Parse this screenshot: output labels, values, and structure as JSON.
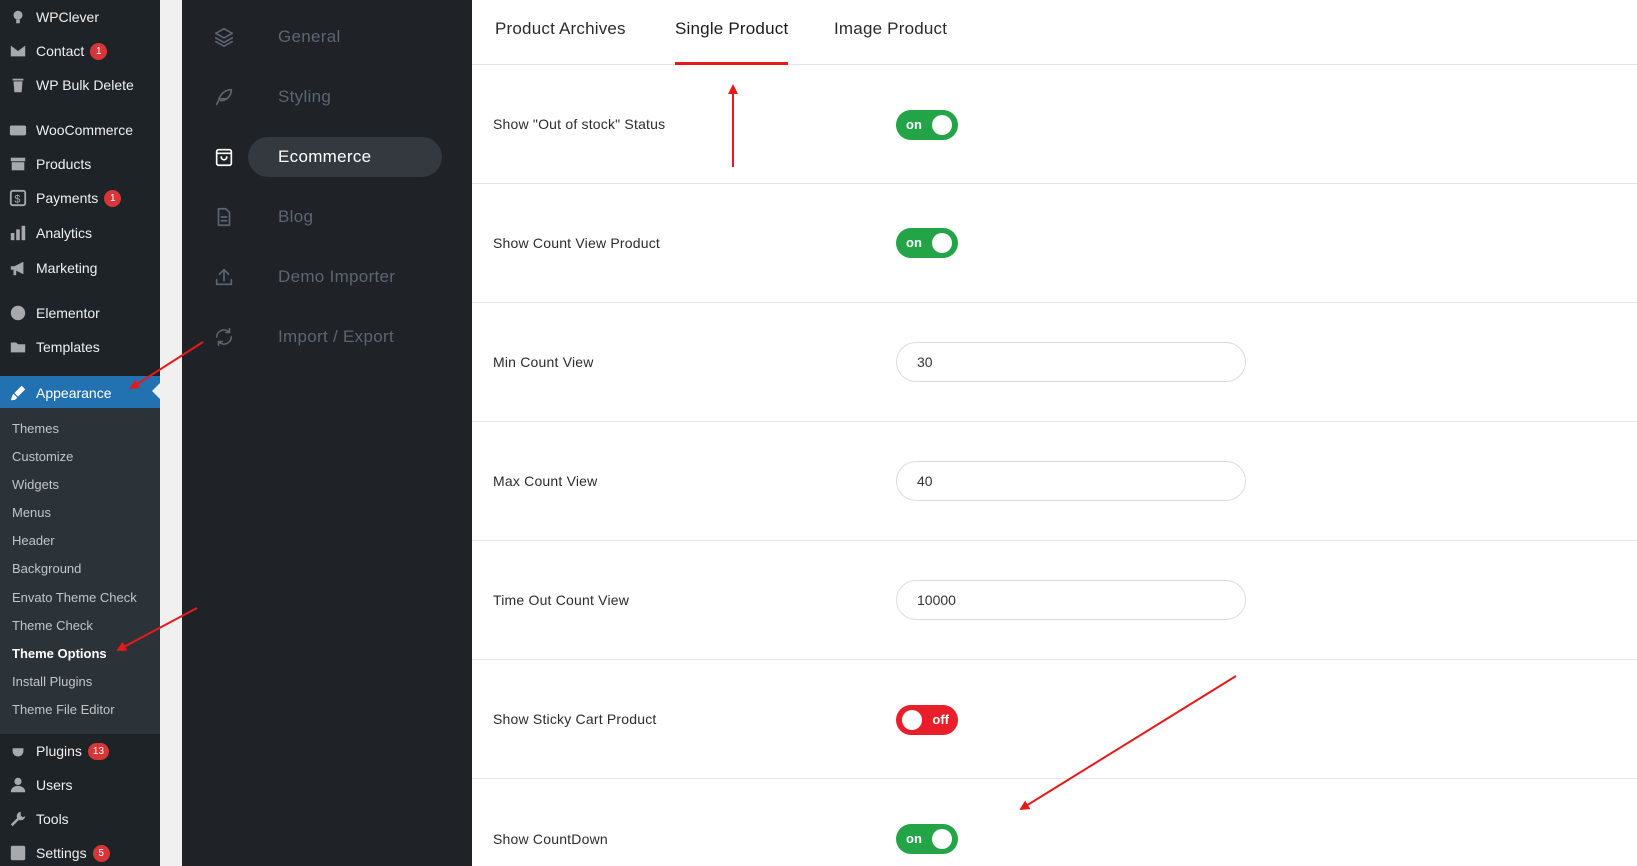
{
  "wp_menu": {
    "wpclever": "WPClever",
    "contact": "Contact",
    "contact_badge": "1",
    "wp_bulk_delete": "WP Bulk Delete",
    "woocommerce": "WooCommerce",
    "products": "Products",
    "payments": "Payments",
    "payments_badge": "1",
    "analytics": "Analytics",
    "marketing": "Marketing",
    "elementor": "Elementor",
    "templates": "Templates",
    "appearance": "Appearance",
    "plugins": "Plugins",
    "plugins_badge": "13",
    "users": "Users",
    "tools": "Tools",
    "settings": "Settings",
    "settings_badge": "5"
  },
  "appearance_submenu": {
    "themes": "Themes",
    "customize": "Customize",
    "widgets": "Widgets",
    "menus": "Menus",
    "header": "Header",
    "background": "Background",
    "envato_theme_check": "Envato Theme Check",
    "theme_check": "Theme Check",
    "theme_options": "Theme Options",
    "install_plugins": "Install Plugins",
    "theme_file_editor": "Theme File Editor"
  },
  "options_nav": {
    "general": "General",
    "styling": "Styling",
    "ecommerce": "Ecommerce",
    "blog": "Blog",
    "demo_importer": "Demo Importer",
    "import_export": "Import / Export"
  },
  "tabs": {
    "product_archives": "Product Archives",
    "single_product": "Single Product",
    "image_product": "Image Product"
  },
  "settings": {
    "out_of_stock": {
      "label": "Show \"Out of stock\" Status",
      "state": "on"
    },
    "count_view": {
      "label": "Show Count View Product",
      "state": "on"
    },
    "min_count": {
      "label": "Min Count View",
      "value": "30"
    },
    "max_count": {
      "label": "Max Count View",
      "value": "40"
    },
    "timeout_count": {
      "label": "Time Out Count View",
      "value": "10000"
    },
    "sticky_cart": {
      "label": "Show Sticky Cart Product",
      "state": "off"
    },
    "countdown": {
      "label": "Show CountDown",
      "state": "on"
    }
  },
  "colors": {
    "wp_sidebar": "#1d2327",
    "wp_active": "#2271b1",
    "options_nav": "#1f2328",
    "toggle_on": "#22a447",
    "toggle_off": "#ea1e2b",
    "tab_underline": "#e51a1a",
    "annotation_arrow": "#e51a1a"
  }
}
